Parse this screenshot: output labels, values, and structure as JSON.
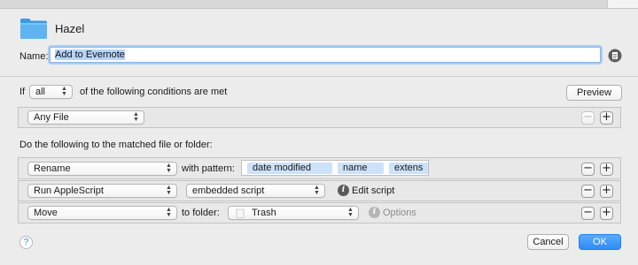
{
  "rule": {
    "app_name": "Hazel",
    "name_label": "Name:",
    "name_value": "Add to Evernote"
  },
  "conditions": {
    "prefix": "If",
    "match_option": "all",
    "suffix": "of the following conditions are met",
    "preview_label": "Preview",
    "rows": [
      {
        "attribute": "Any File"
      }
    ]
  },
  "actions": {
    "heading": "Do the following to the matched file or folder:",
    "rows": [
      {
        "action": "Rename",
        "pattern_label": "with pattern:",
        "tokens": [
          "date modified",
          "name",
          "extens"
        ]
      },
      {
        "action": "Run AppleScript",
        "script_option": "embedded script",
        "edit_label": "Edit script"
      },
      {
        "action": "Move",
        "folder_label": "to folder:",
        "folder": "Trash",
        "options_label": "Options"
      }
    ]
  },
  "footer": {
    "cancel_label": "Cancel",
    "ok_label": "OK",
    "help_symbol": "?"
  },
  "icons": {
    "folder": "folder-icon",
    "info": "info-icon",
    "help": "help-icon",
    "chevron": "up-down-chevron-icon"
  },
  "colors": {
    "accent": "#2f8cf8",
    "folder": "#5db4f1",
    "token": "#cde1f9",
    "window_bg": "#ececec"
  }
}
